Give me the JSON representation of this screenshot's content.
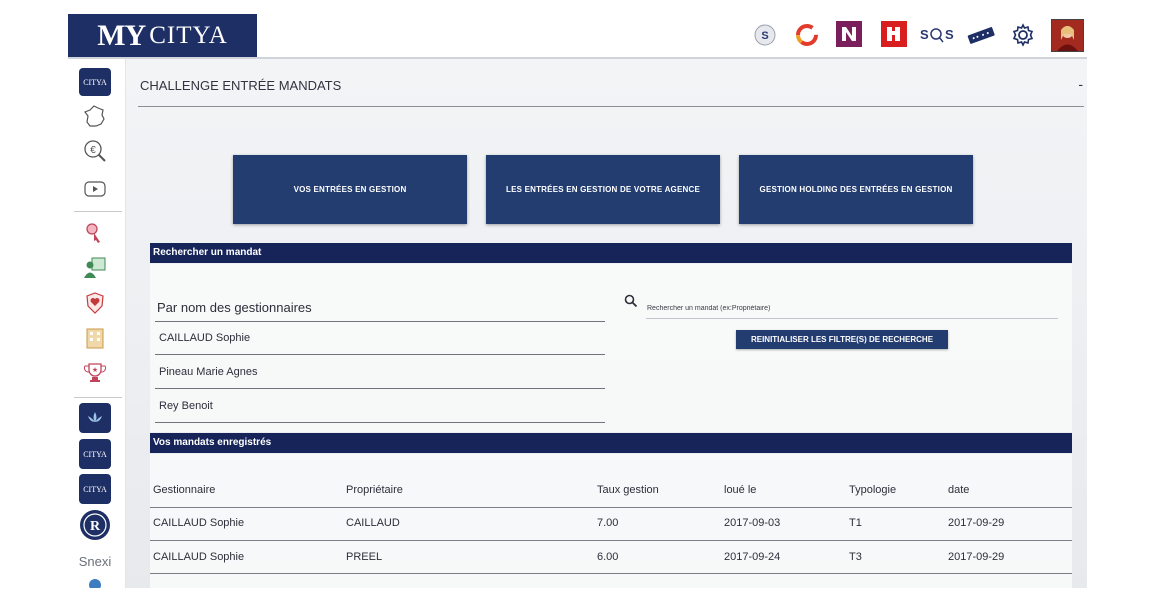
{
  "header": {
    "logo_my": "MY",
    "logo_citya": "CITYA",
    "icons": [
      "s-circle-icon",
      "c-ring-icon",
      "n-square-icon",
      "n-red-icon",
      "sos-icon",
      "domino-icon",
      "gear-icon",
      "user-avatar"
    ],
    "sos_text": "S S"
  },
  "sidebar": {
    "items": [
      "citya-immobilier-icon",
      "france-map-icon",
      "euro-search-icon",
      "video-play-icon",
      "key-icon",
      "people-board-icon",
      "heart-shield-icon",
      "building-icon",
      "trophy-icon",
      "lotus-badge-icon",
      "citya-badge-icon",
      "citya-assurances-icon",
      "r-circle-icon",
      "snexi-icon"
    ],
    "badge_citya": "CITYA",
    "snexi": "Snexi"
  },
  "main": {
    "title": "CHALLENGE ENTRÉE MANDATS",
    "collapse": "-",
    "buttons": [
      "VOS ENTRÉES EN GESTION",
      "LES ENTRÉES EN GESTION DE VOTRE AGENCE",
      "GESTION HOLDING DES ENTRÉES EN GESTION"
    ]
  },
  "search": {
    "bar_title": "Rechercher un mandat",
    "gestionnaires_label": "Par nom des gestionnaires",
    "gestionnaires": [
      "CAILLAUD Sophie",
      "Pineau Marie Agnes",
      "Rey Benoit"
    ],
    "placeholder": "Rechercher un mandat (ex:Propriétaire)",
    "reset_label": "REINITIALISER LES FILTRE(S) DE RECHERCHE"
  },
  "mandats": {
    "bar_title": "Vos mandats enregistrés",
    "columns": [
      "Gestionnaire",
      "Propriétaire",
      "Taux gestion",
      "loué le",
      "Typologie",
      "date"
    ],
    "rows": [
      [
        "CAILLAUD Sophie",
        "CAILLAUD",
        "7.00",
        "2017-09-03",
        "T1",
        "2017-09-29"
      ],
      [
        "CAILLAUD Sophie",
        "PREEL",
        "6.00",
        "2017-09-24",
        "T3",
        "2017-09-29"
      ]
    ]
  },
  "colors": {
    "brand_navy": "#1e2f66",
    "button_blue": "#233d70",
    "bar_navy": "#17245a"
  }
}
